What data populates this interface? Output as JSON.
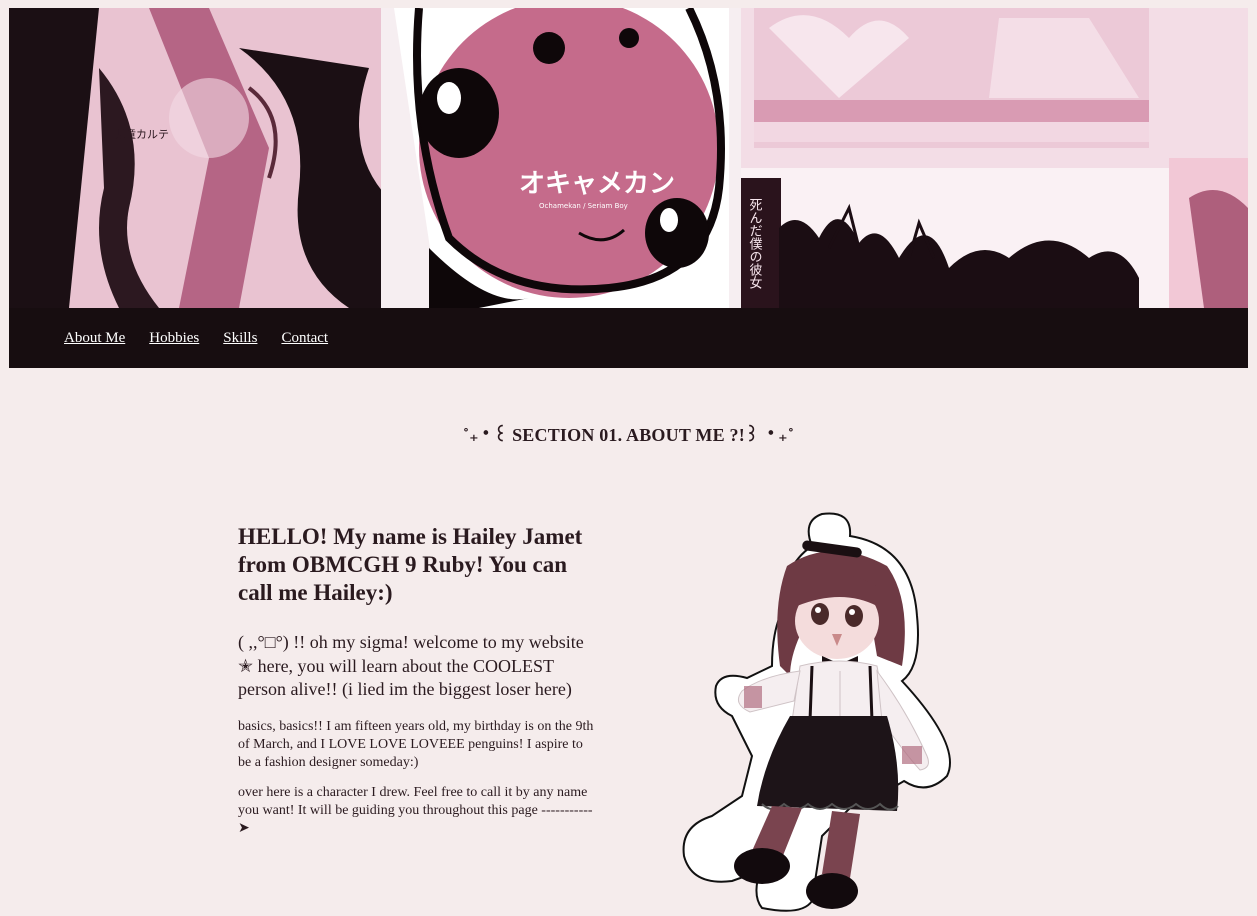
{
  "nav": {
    "items": [
      {
        "label": "About Me"
      },
      {
        "label": "Hobbies"
      },
      {
        "label": "Skills"
      },
      {
        "label": "Contact"
      }
    ]
  },
  "section": {
    "heading": "˚₊‧꒰ SECTION 01. ABOUT ME ?!꒱ ‧₊˚"
  },
  "intro": {
    "title": "HELLO! My name is Hailey Jamet from OBMCGH 9 Ruby! You can call me Hailey:)",
    "lead": "( ,,°□°) !! oh my sigma! welcome to my website ✭ here, you will learn about the COOLEST person alive!! (i lied im the biggest loser here)",
    "basics": "basics, basics!! I am fifteen years old, my birthday is on the 9th of March, and I LOVE LOVE LOVEEE penguins! I aspire to be a fashion designer someday:)",
    "character_note": "over here is a character I drew. Feel free to call it by any name you want! It will be guiding you throughout this page -----------➤"
  },
  "banner": {
    "logo_text": "オキャメカン",
    "logo_sub": "Ochamekan / Seriam Boy",
    "vertical_text": "死んだ僕の彼女",
    "small_text": "児童カルテ"
  },
  "colors": {
    "background": "#f5ecec",
    "nav_bg": "#170d10",
    "text": "#2a1a1f",
    "banner_pink": "#c56b8b"
  }
}
